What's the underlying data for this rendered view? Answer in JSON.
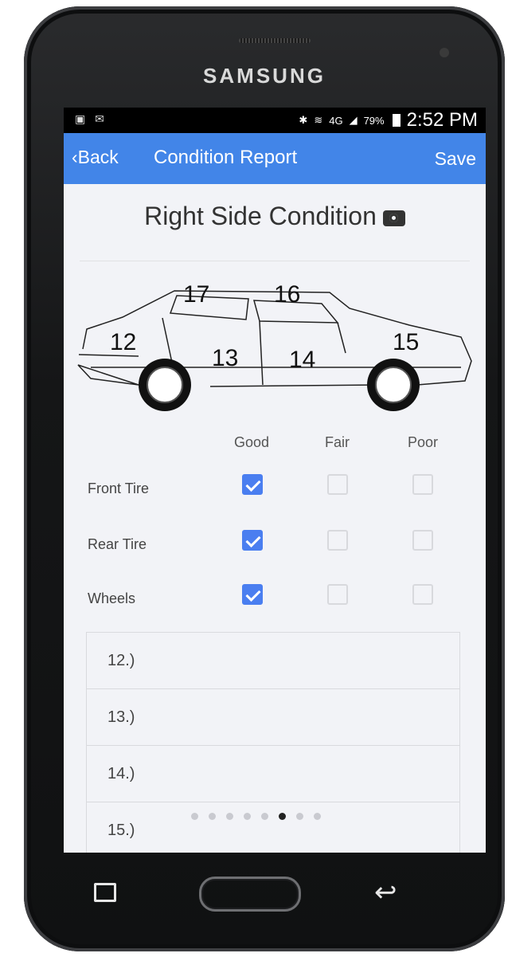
{
  "device": {
    "brand": "SAMSUNG"
  },
  "status_bar": {
    "time": "2:52 PM",
    "battery": "79%",
    "network": "4G"
  },
  "nav": {
    "back_label": "‹Back",
    "title": "Condition Report",
    "save_label": "Save"
  },
  "section": {
    "title": "Right Side Condition"
  },
  "car_zones": [
    "17",
    "16",
    "12",
    "13",
    "14",
    "15"
  ],
  "columns": {
    "good": "Good",
    "fair": "Fair",
    "poor": "Poor"
  },
  "rows": [
    {
      "label": "Front Tire",
      "good": true,
      "fair": false,
      "poor": false
    },
    {
      "label": "Rear Tire",
      "good": true,
      "fair": false,
      "poor": false
    },
    {
      "label": "Wheels",
      "good": true,
      "fair": false,
      "poor": false
    }
  ],
  "notes": [
    "12.)",
    "13.)",
    "14.)",
    "15.)"
  ],
  "pager": {
    "count": 8,
    "active_index": 5
  },
  "colors": {
    "accent": "#4285e8",
    "checkbox_checked": "#4a7ef0",
    "screen_bg": "#f2f3f7"
  }
}
